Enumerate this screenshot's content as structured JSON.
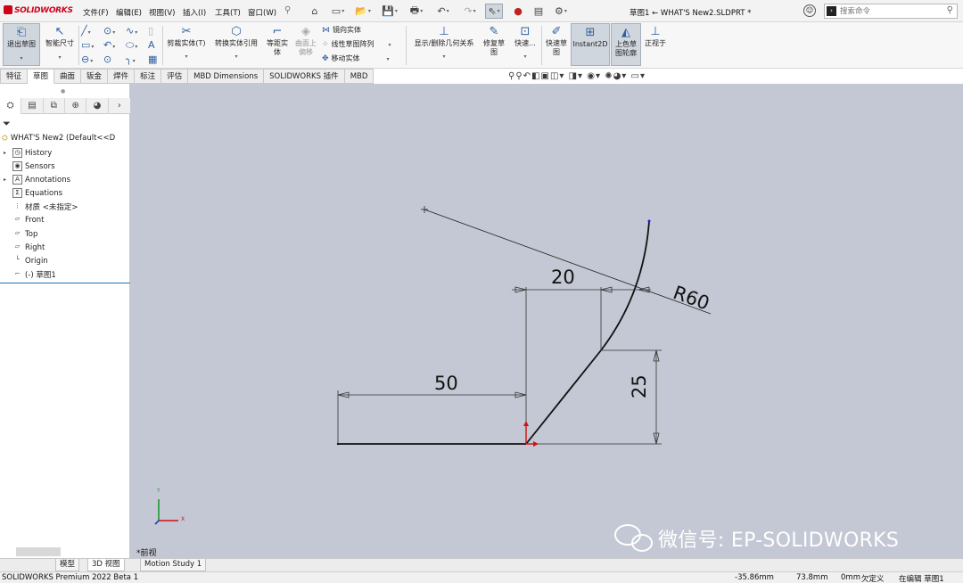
{
  "app": {
    "logo_text": "SOLIDWORKS",
    "document_title": "草图1 ← WHAT'S New2.SLDPRT *",
    "brand_color": "#d0021b"
  },
  "menu": [
    "文件(F)",
    "编辑(E)",
    "视图(V)",
    "插入(I)",
    "工具(T)",
    "窗口(W)"
  ],
  "quick_access_icons": [
    "home-icon",
    "new-file-icon",
    "open-file-icon",
    "save-icon",
    "print-icon",
    "undo-icon",
    "redo-icon",
    "select-icon",
    "traffic-light-icon",
    "file-properties-icon",
    "options-icon"
  ],
  "search": {
    "placeholder": "搜索命令"
  },
  "toolbar": {
    "exit_sketch": "退出草图",
    "smart_dimension": "智能尺寸",
    "trim": "剪裁实体(T)",
    "convert": "转换实体引用",
    "offset_line1": "等距实",
    "offset_line2": "体",
    "surface_offset_line1": "曲面上",
    "surface_offset_line2": "偏移",
    "mirror": "镜向实体",
    "linear_pattern": "线性草图阵列",
    "move": "移动实体",
    "relations": "显示/删除几何关系",
    "repair_line1": "修复草",
    "repair_line2": "图",
    "quick_snaps": "快速...",
    "rapid_sketch_line1": "快速草",
    "rapid_sketch_line2": "图",
    "instant2d": "Instant2D",
    "shaded_contours_line1": "上色草",
    "shaded_contours_line2": "图轮廓",
    "normal_to": "正视于"
  },
  "tabs": [
    "特征",
    "草图",
    "曲面",
    "钣金",
    "焊件",
    "标注",
    "评估",
    "MBD Dimensions",
    "SOLIDWORKS 插件",
    "MBD"
  ],
  "active_tab": "草图",
  "tree": {
    "root": "WHAT'S New2  (Default<<D",
    "items": [
      "History",
      "Sensors",
      "Annotations",
      "Equations",
      "材质 <未指定>",
      "Front",
      "Top",
      "Right",
      "Origin",
      "(-) 草图1"
    ]
  },
  "sketch": {
    "dim_horizontal_top": "20",
    "dim_horizontal_bottom": "50",
    "dim_vertical": "25",
    "dim_radius": "R60",
    "view_label": "*前视"
  },
  "watermark": "微信号: EP-SOLIDWORKS",
  "bottom_tabs": [
    "模型",
    "3D 视图",
    "Motion Study 1"
  ],
  "status": {
    "product": "SOLIDWORKS Premium 2022 Beta 1",
    "x": "-35.86mm",
    "y": "73.8mm",
    "z": "0mm",
    "state": "欠定义",
    "editing": "在编辑 草图1"
  }
}
